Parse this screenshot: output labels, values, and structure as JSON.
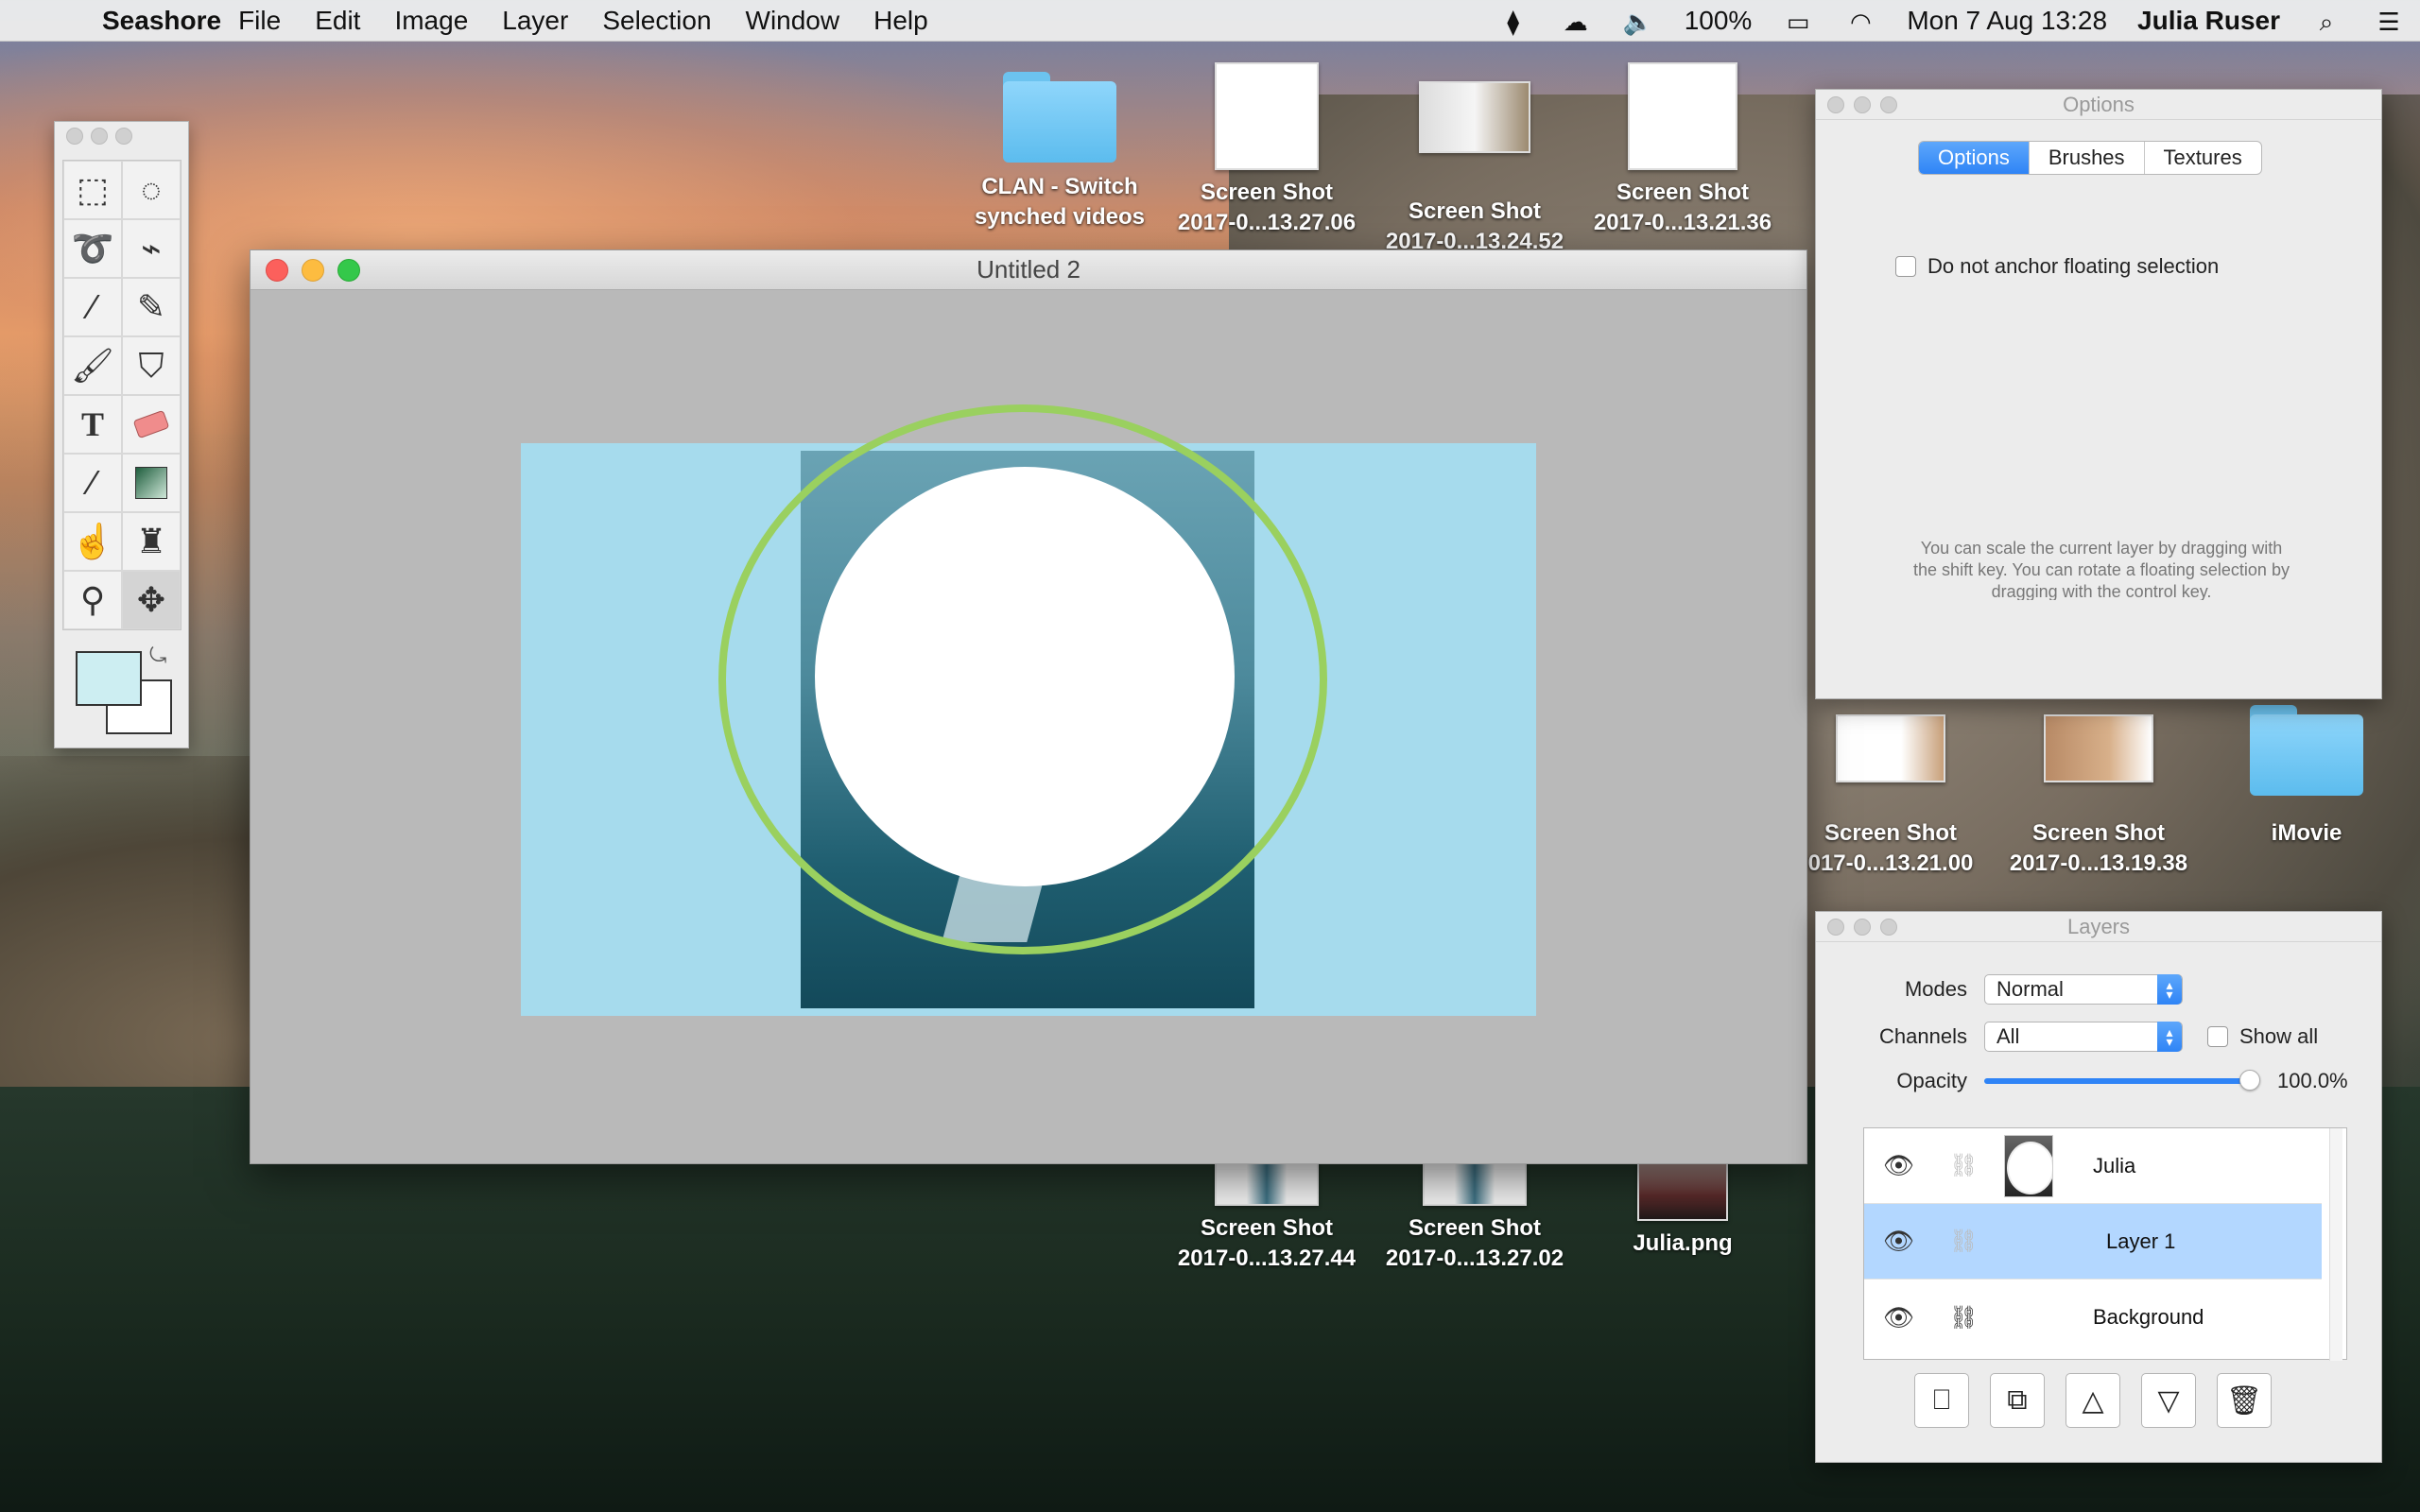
{
  "menubar": {
    "app_name": "Seashore",
    "menus": [
      "File",
      "Edit",
      "Image",
      "Layer",
      "Selection",
      "Window",
      "Help"
    ],
    "battery": "100%",
    "datetime": "Mon 7 Aug  13:28",
    "user": "Julia Ruser"
  },
  "desktop": {
    "icons": [
      {
        "line1": "CLAN - Switch",
        "line2": "synched videos"
      },
      {
        "line1": "Screen Shot",
        "line2": "2017-0...13.27.06"
      },
      {
        "line1": "Screen Shot",
        "line2": "2017-0...13.24.52"
      },
      {
        "line1": "Screen Shot",
        "line2": "2017-0...13.21.36"
      },
      {
        "line1": "Screen Shot",
        "line2": "017-0...13.21.00"
      },
      {
        "line1": "Screen Shot",
        "line2": "2017-0...13.19.38"
      },
      {
        "line1": "iMovie",
        "line2": ""
      },
      {
        "line1": "Screen Shot",
        "line2": "2017-0...13.27.44"
      },
      {
        "line1": "Screen Shot",
        "line2": "2017-0...13.27.02"
      },
      {
        "line1": "Julia.png",
        "line2": ""
      }
    ]
  },
  "document": {
    "title": "Untitled 2"
  },
  "options_panel": {
    "title": "Options",
    "tabs": [
      "Options",
      "Brushes",
      "Textures"
    ],
    "checkbox_label": "Do not anchor floating selection",
    "hint": "You can scale the current layer by dragging with the shift key. You can rotate a floating selection by dragging with the control key."
  },
  "layers_panel": {
    "title": "Layers",
    "modes_label": "Modes",
    "modes_value": "Normal",
    "channels_label": "Channels",
    "channels_value": "All",
    "show_all_label": "Show all",
    "opacity_label": "Opacity",
    "opacity_value": "100.0%",
    "layers": [
      {
        "name": "Julia"
      },
      {
        "name": "Layer 1"
      },
      {
        "name": "Background"
      }
    ]
  },
  "colors": {
    "canvas": "#a6dbed",
    "ring": "#9ad05f",
    "selection": "#b3d7ff",
    "foreground_swatch": "#cdeef2",
    "background_swatch": "#ffffff"
  }
}
